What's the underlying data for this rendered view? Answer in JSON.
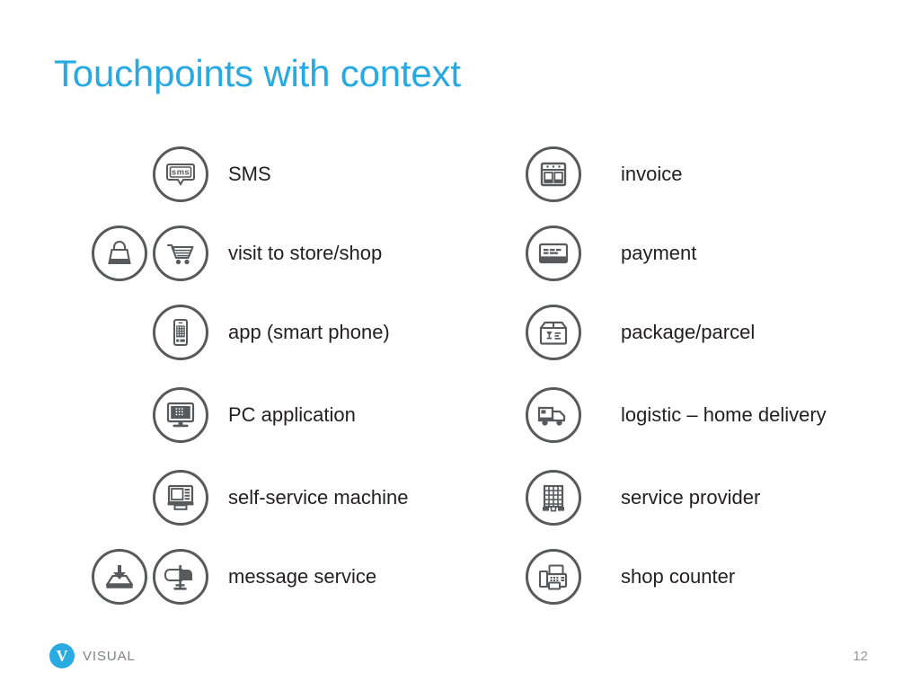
{
  "slide": {
    "title": "Touchpoints with context",
    "page_number": "12"
  },
  "footer": {
    "logo_letter": "V",
    "logo_text": "VISUAL",
    "logo_color": "#29abe2"
  },
  "theme": {
    "title_color": "#27a9e1",
    "icon_stroke_color": "#58595b",
    "label_color": "#231f20",
    "page_number_color": "#939598"
  },
  "columns": {
    "left": [
      {
        "label": "SMS",
        "icons": [
          "sms-bubble-icon"
        ]
      },
      {
        "label": "visit to store/shop",
        "icons": [
          "shopping-bag-icon",
          "shopping-cart-icon"
        ]
      },
      {
        "label": "app (smart phone)",
        "icons": [
          "smartphone-icon"
        ]
      },
      {
        "label": "PC application",
        "icons": [
          "desktop-monitor-icon"
        ]
      },
      {
        "label": "self-service machine",
        "icons": [
          "atm-kiosk-icon"
        ]
      },
      {
        "label": "message service",
        "icons": [
          "inbox-download-icon",
          "mailbox-icon"
        ]
      }
    ],
    "right": [
      {
        "label": "invoice",
        "icons": [
          "invoice-document-icon"
        ]
      },
      {
        "label": "payment",
        "icons": [
          "credit-card-icon"
        ]
      },
      {
        "label": "package/parcel",
        "icons": [
          "parcel-box-icon"
        ]
      },
      {
        "label": "logistic – home delivery",
        "icons": [
          "delivery-truck-icon"
        ]
      },
      {
        "label": "service provider",
        "icons": [
          "office-building-icon"
        ]
      },
      {
        "label": "shop counter",
        "icons": [
          "fax-terminal-icon"
        ]
      }
    ]
  }
}
